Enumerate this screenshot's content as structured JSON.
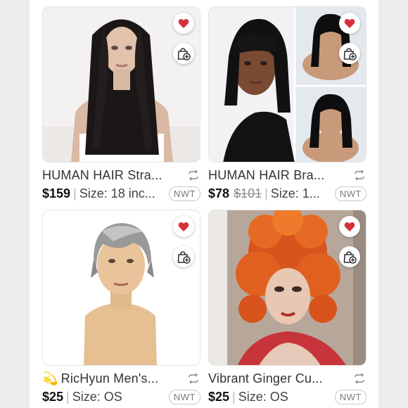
{
  "listings": [
    {
      "title": "HUMAN HAIR Stra...",
      "title_emoji": "",
      "price": "$159",
      "original_price": "",
      "size": "Size: 18 inc...",
      "condition": "NWT",
      "image_desc": "mannequin-straight-black-wig"
    },
    {
      "title": "HUMAN HAIR Bra...",
      "title_emoji": "",
      "price": "$78",
      "original_price": "$101",
      "size": "Size: 1...",
      "condition": "NWT",
      "image_desc": "model-black-bob-bangs-wig"
    },
    {
      "title": "RicHyun Men's...",
      "title_emoji": "💫",
      "price": "$25",
      "original_price": "",
      "size": "Size: OS",
      "condition": "NWT",
      "image_desc": "mannequin-gray-short-men-wig"
    },
    {
      "title": "Vibrant Ginger Cu...",
      "title_emoji": "",
      "price": "$25",
      "original_price": "",
      "size": "Size: OS",
      "condition": "NWT",
      "image_desc": "model-curly-ginger-wig"
    }
  ],
  "colors": {
    "like_heart": "#d6303b",
    "price_text": "#111111",
    "strike_price": "#8a8a8a",
    "side_panel": "#ececef"
  },
  "icons": {
    "like": "heart-icon",
    "bundle": "shopping-bag-plus-icon",
    "resell": "repost-arrows-icon"
  }
}
